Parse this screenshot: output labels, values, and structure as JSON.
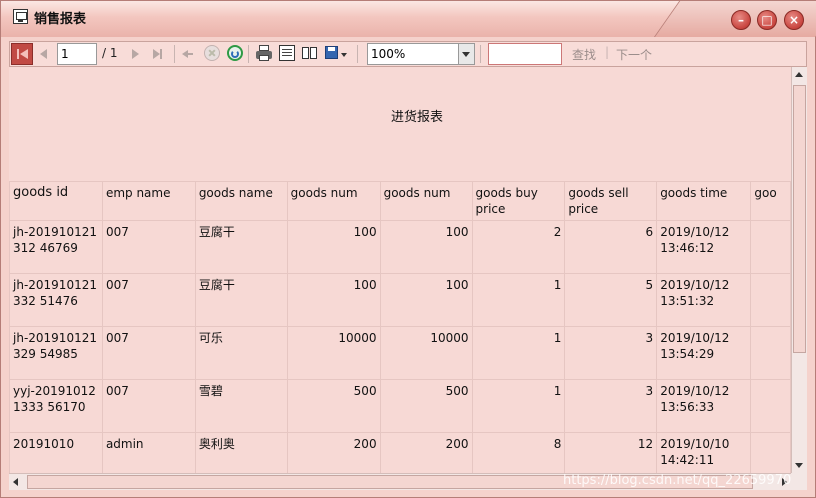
{
  "window": {
    "title": "销售报表",
    "colors": {
      "accent": "#c8453f",
      "background": "#f5d2cc",
      "titlebar": "#eab3ab"
    },
    "controls": {
      "minimize": "–",
      "maximize": "□",
      "close": "×"
    }
  },
  "toolbar": {
    "page_value": "1",
    "page_total": "/ 1",
    "zoom_value": "100%",
    "find_placeholder": "",
    "find_label": "查找",
    "separator": "|",
    "next_label": "下一个",
    "icons": [
      "first-page-icon",
      "prev-page-icon",
      "next-page-icon",
      "last-page-icon",
      "back-icon",
      "stop-icon",
      "refresh-icon",
      "print-icon",
      "print-layout-icon",
      "page-setup-icon",
      "export-icon"
    ]
  },
  "report": {
    "title": "进货报表",
    "columns": [
      "goods id",
      "emp name",
      "goods name",
      "goods num",
      "goods num",
      "goods buy price",
      "goods sell price",
      "goods time",
      "goo"
    ],
    "rows": [
      {
        "id": "jh-201910121312 46769",
        "emp": "007",
        "goods": "豆腐干",
        "num1": "100",
        "num2": "100",
        "buy": "2",
        "sell": "6",
        "time": "2019/10/12 13:46:12"
      },
      {
        "id": "jh-201910121332 51476",
        "emp": "007",
        "goods": "豆腐干",
        "num1": "100",
        "num2": "100",
        "buy": "1",
        "sell": "5",
        "time": "2019/10/12 13:51:32"
      },
      {
        "id": "jh-201910121329 54985",
        "emp": "007",
        "goods": "可乐",
        "num1": "10000",
        "num2": "10000",
        "buy": "1",
        "sell": "3",
        "time": "2019/10/12 13:54:29"
      },
      {
        "id": "yyj-201910121333 56170",
        "emp": "007",
        "goods": "雪碧",
        "num1": "500",
        "num2": "500",
        "buy": "1",
        "sell": "3",
        "time": "2019/10/12 13:56:33"
      },
      {
        "id": "20191010",
        "emp": "admin",
        "goods": "奥利奥",
        "num1": "200",
        "num2": "200",
        "buy": "8",
        "sell": "12",
        "time": "2019/10/10 14:42:11"
      }
    ]
  },
  "watermark": "https://blog.csdn.net/qq_22659970"
}
